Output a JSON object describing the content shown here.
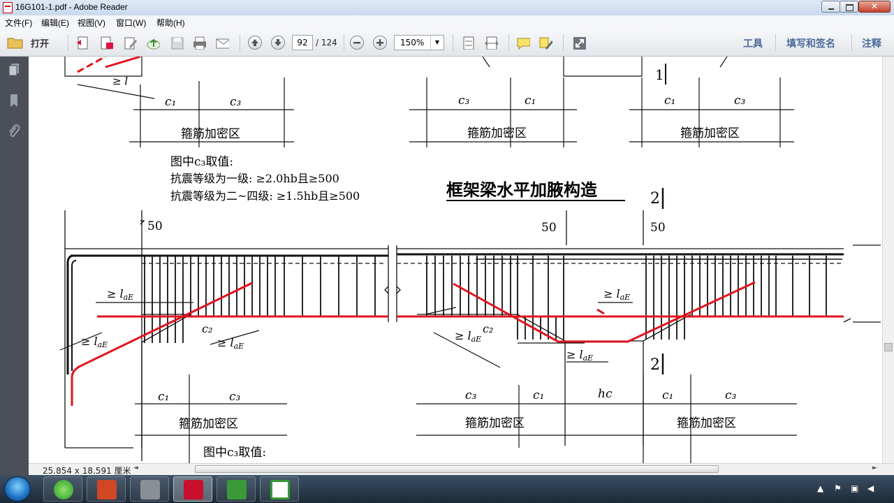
{
  "window": {
    "title": "16G101-1.pdf - Adobe Reader"
  },
  "menu": [
    "文件(F)",
    "编辑(E)",
    "视图(V)",
    "窗口(W)",
    "帮助(H)"
  ],
  "toolbar": {
    "open_label": "打开",
    "page_current": "92",
    "page_total": "/ 124",
    "zoom": "150%",
    "tools_label": "工具",
    "fill_sign_label": "填写和签名",
    "comment_label": "注释"
  },
  "status": {
    "dimensions": "25.854 x 18.591 厘米"
  },
  "document": {
    "heading": "框架梁水平加腋构造",
    "zone_label": "箍筋加密区",
    "c1": "c₁",
    "c2": "c₂",
    "c3": "c₃",
    "hc": "hc",
    "lae": "≥ l",
    "lae_sub": "aE",
    "note_title": "图中c₃取值:",
    "note_line1": "抗震等级为一级:  ≥2.0hb且≥500",
    "note_line2": "抗震等级为二~四级:  ≥1.5hb且≥500",
    "dim_50": "50",
    "section_1": "1",
    "section_2": "2"
  },
  "colors": {
    "rebar_red": "#e0141e",
    "drawing_black": "#111111",
    "toolbar_blue": "#4a6a9a"
  }
}
